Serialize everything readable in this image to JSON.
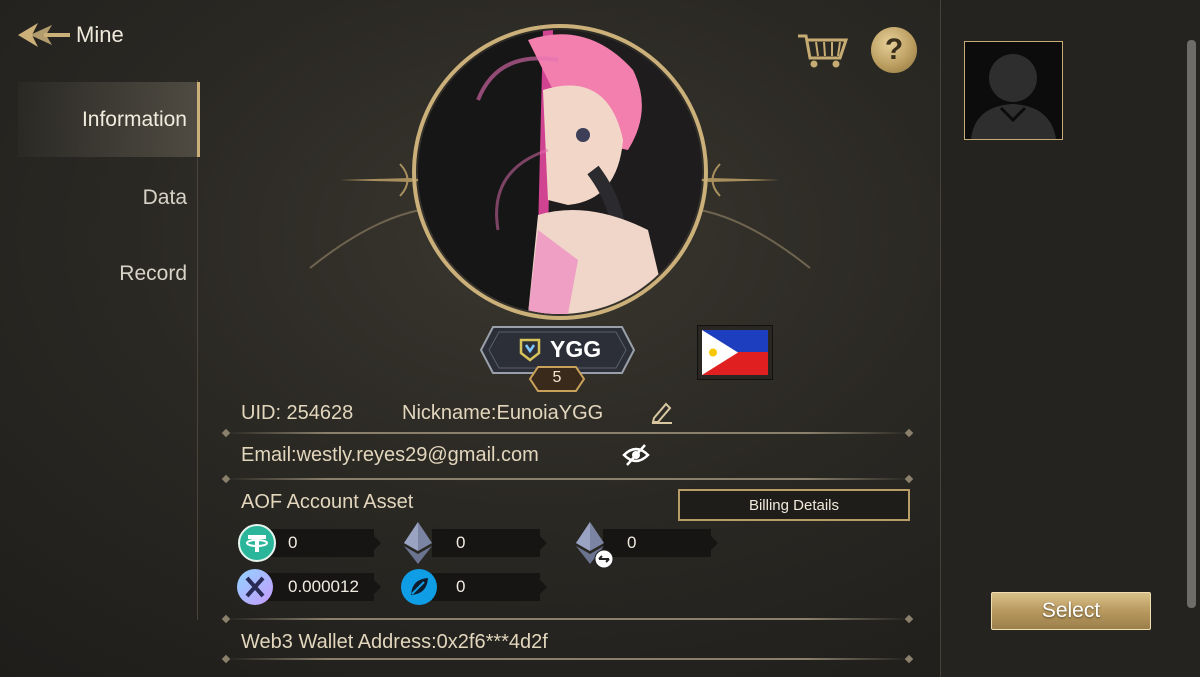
{
  "header": {
    "title": "Mine",
    "back_icon": "back-arrow-icon"
  },
  "sidebar": {
    "items": [
      {
        "label": "Information",
        "active": true
      },
      {
        "label": "Data",
        "active": false
      },
      {
        "label": "Record",
        "active": false
      }
    ]
  },
  "profile": {
    "guild_tag": "YGG",
    "level": "5",
    "flag_icon": "philippines-flag-icon",
    "uid": "UID: 254628",
    "nickname": "Nickname:EunoiaYGG",
    "email": "Email:westly.reyes29@gmail.com",
    "wallet": "Web3 Wallet Address:0x2f6***4d2f"
  },
  "assets": {
    "title": "AOF Account Asset",
    "billing_label": "Billing Details",
    "items": [
      {
        "icon": "tether-coin-icon",
        "value": "0"
      },
      {
        "icon": "ethereum-coin-icon",
        "value": "0"
      },
      {
        "icon": "bridged-ethereum-coin-icon",
        "value": "0"
      },
      {
        "icon": "x-token-coin-icon",
        "value": "0.000012"
      },
      {
        "icon": "leaf-token-coin-icon",
        "value": "0"
      }
    ]
  },
  "right_panel": {
    "select_label": "Select"
  },
  "colors": {
    "accent_gold": "#cbb07a",
    "background": "#2a2823",
    "text": "#e2d6bd"
  }
}
